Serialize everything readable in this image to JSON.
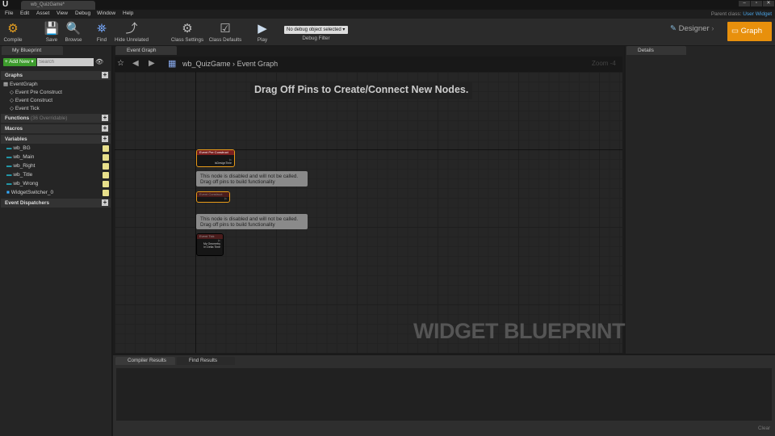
{
  "window": {
    "doc_tab": "wb_QuizGame*",
    "parent_class_label": "Parent class:",
    "parent_class": "User Widget"
  },
  "menu": [
    "File",
    "Edit",
    "Asset",
    "View",
    "Debug",
    "Window",
    "Help"
  ],
  "toolbar": {
    "compile": "Compile",
    "save": "Save",
    "browse": "Browse",
    "find": "Find",
    "hide_unrelated": "Hide Unrelated",
    "class_settings": "Class Settings",
    "class_defaults": "Class Defaults",
    "play": "Play",
    "debug_select": "No debug object selected ▾",
    "debug_filter": "Debug Filter"
  },
  "mode": {
    "designer": "Designer",
    "graph": "Graph",
    "accent": "#e8900c",
    "arrow_color": "#f7a8d8"
  },
  "my_blueprint": {
    "tab": "My Blueprint",
    "add_new": "Add New ▾",
    "search_placeholder": "Search",
    "graphs": "Graphs",
    "event_graph": "EventGraph",
    "events": [
      "Event Pre Construct",
      "Event Construct",
      "Event Tick"
    ],
    "functions": "Functions",
    "functions_note": "(36 Overridable)",
    "macros": "Macros",
    "variables": "Variables",
    "vars": [
      "wb_BG",
      "wb_Main",
      "wb_Right",
      "wb_Title",
      "wb_Wrong",
      "WidgetSwitcher_0"
    ],
    "dispatchers": "Event Dispatchers"
  },
  "graph": {
    "tab": "Event Graph",
    "crumb_root": "wb_QuizGame",
    "crumb_sep": "›",
    "crumb_leaf": "Event Graph",
    "zoom": "Zoom -4",
    "hint": "Drag Off Pins to Create/Connect New Nodes.",
    "watermark": "WIDGET BLUEPRINT",
    "nodes": [
      {
        "title": "Event Pre Construct",
        "pin": "IsDesignTime"
      },
      {
        "title": "Event Construct"
      },
      {
        "title": "Event Tick",
        "pins": [
          "My Geometry",
          "In Delta Time"
        ]
      }
    ],
    "comment_line1": "This node is disabled and will not be called.",
    "comment_line2": "Drag off pins to build functionality"
  },
  "details": {
    "tab": "Details"
  },
  "bottom": {
    "tabs": [
      "Compiler Results",
      "Find Results"
    ],
    "clear": "Clear"
  }
}
